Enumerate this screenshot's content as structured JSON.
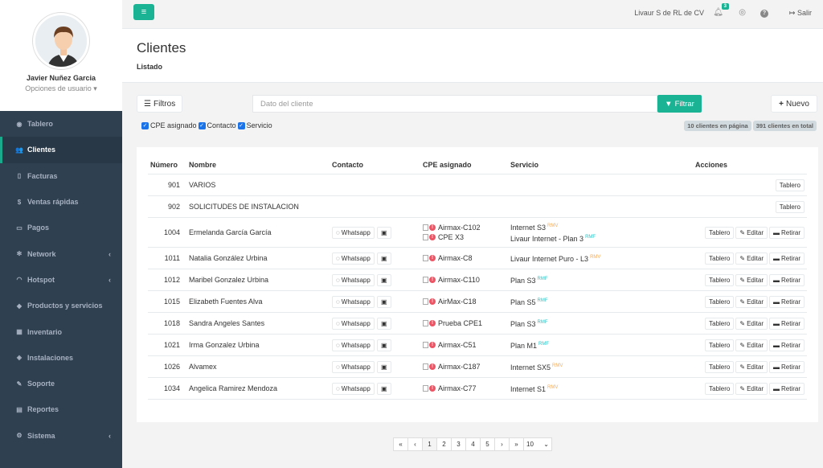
{
  "user": {
    "name": "Javier Nuñez Garcia",
    "options": "Opciones de usuario"
  },
  "sidebar": {
    "items": [
      {
        "label": "Tablero",
        "icon": "dashboard-icon",
        "glyph": "◉"
      },
      {
        "label": "Clientes",
        "icon": "users-icon",
        "glyph": "👥",
        "active": true
      },
      {
        "label": "Facturas",
        "icon": "file-icon",
        "glyph": "▯"
      },
      {
        "label": "Ventas rápidas",
        "icon": "dollar-icon",
        "glyph": "$"
      },
      {
        "label": "Pagos",
        "icon": "money-icon",
        "glyph": "▭"
      },
      {
        "label": "Network",
        "icon": "network-icon",
        "glyph": "✻",
        "caret": "‹"
      },
      {
        "label": "Hotspot",
        "icon": "wifi-icon",
        "glyph": "◠",
        "caret": "‹"
      },
      {
        "label": "Productos y servicios",
        "icon": "tag-icon",
        "glyph": "◆"
      },
      {
        "label": "Inventario",
        "icon": "cubes-icon",
        "glyph": "▦"
      },
      {
        "label": "Instalaciones",
        "icon": "tools-icon",
        "glyph": "◈"
      },
      {
        "label": "Soporte",
        "icon": "wrench-icon",
        "glyph": "✎"
      },
      {
        "label": "Reportes",
        "icon": "book-icon",
        "glyph": "▤"
      },
      {
        "label": "Sistema",
        "icon": "cogs-icon",
        "glyph": "⚙",
        "caret": "‹"
      }
    ]
  },
  "topbar": {
    "company": "Livaur S de RL de CV",
    "notifications": "3",
    "logout": "Salir"
  },
  "page": {
    "title": "Clientes",
    "subtitle": "Listado"
  },
  "filters": {
    "filtros_label": "Filtros",
    "search_placeholder": "Dato del cliente",
    "filtrar_label": "Filtrar",
    "nuevo_label": "Nuevo",
    "checks": [
      "CPE asignado",
      "Contacto",
      "Servicio"
    ],
    "count_page": "10 clientes en página",
    "count_total": "391 clientes en total"
  },
  "table": {
    "headers": [
      "Número",
      "Nombre",
      "Contacto",
      "CPE asignado",
      "Servicio",
      "Acciones"
    ],
    "whatsapp_label": "Whatsapp",
    "tablero_label": "Tablero",
    "editar_label": "Editar",
    "retirar_label": "Retirar",
    "rows": [
      {
        "num": "901",
        "name": "VARIOS",
        "contact": false,
        "cpes": [],
        "services": [],
        "full": false
      },
      {
        "num": "902",
        "name": "SOLICITUDES DE INSTALACION",
        "contact": false,
        "cpes": [],
        "services": [],
        "full": false
      },
      {
        "num": "1004",
        "name": "Ermelanda García García",
        "contact": true,
        "cpes": [
          "Airmax-C102",
          "CPE X3"
        ],
        "services": [
          {
            "name": "Internet S3",
            "tag": "RMV"
          },
          {
            "name": "Livaur Internet - Plan 3",
            "tag": "RMF"
          }
        ],
        "full": true
      },
      {
        "num": "1011",
        "name": "Natalia González Urbina",
        "contact": true,
        "cpes": [
          "Airmax-C8"
        ],
        "services": [
          {
            "name": "Livaur Internet Puro - L3",
            "tag": "RMV"
          }
        ],
        "full": true
      },
      {
        "num": "1012",
        "name": "Maribel Gonzalez Urbina",
        "contact": true,
        "cpes": [
          "Airmax-C110"
        ],
        "services": [
          {
            "name": "Plan S3",
            "tag": "RMF"
          }
        ],
        "full": true
      },
      {
        "num": "1015",
        "name": "Elizabeth Fuentes Alva",
        "contact": true,
        "cpes": [
          "AirMax-C18"
        ],
        "services": [
          {
            "name": "Plan S5",
            "tag": "RMF"
          }
        ],
        "full": true
      },
      {
        "num": "1018",
        "name": "Sandra Angeles Santes",
        "contact": true,
        "cpes": [
          "Prueba CPE1"
        ],
        "services": [
          {
            "name": "Plan S3",
            "tag": "RMF"
          }
        ],
        "full": true
      },
      {
        "num": "1021",
        "name": "Irma Gonzalez Urbina",
        "contact": true,
        "cpes": [
          "Airmax-C51"
        ],
        "services": [
          {
            "name": "Plan M1",
            "tag": "RMF"
          }
        ],
        "full": true
      },
      {
        "num": "1026",
        "name": "Alvamex",
        "contact": true,
        "cpes": [
          "Airmax-C187"
        ],
        "services": [
          {
            "name": "Internet SX5",
            "tag": "RMV"
          }
        ],
        "full": true
      },
      {
        "num": "1034",
        "name": "Angelica Ramirez Mendoza",
        "contact": true,
        "cpes": [
          "Airmax-C77"
        ],
        "services": [
          {
            "name": "Internet S1",
            "tag": "RMV"
          }
        ],
        "full": true
      }
    ]
  },
  "pagination": {
    "items": [
      "«",
      "‹",
      "1",
      "2",
      "3",
      "4",
      "5",
      "›",
      "»"
    ],
    "active": "1",
    "per_page": "10"
  },
  "colors": {
    "sidebar": "#2f4050",
    "accent": "#1ab394",
    "danger": "#ed5565",
    "tag_rmv": "#f8ac59",
    "tag_rmf": "#23c6c8"
  }
}
